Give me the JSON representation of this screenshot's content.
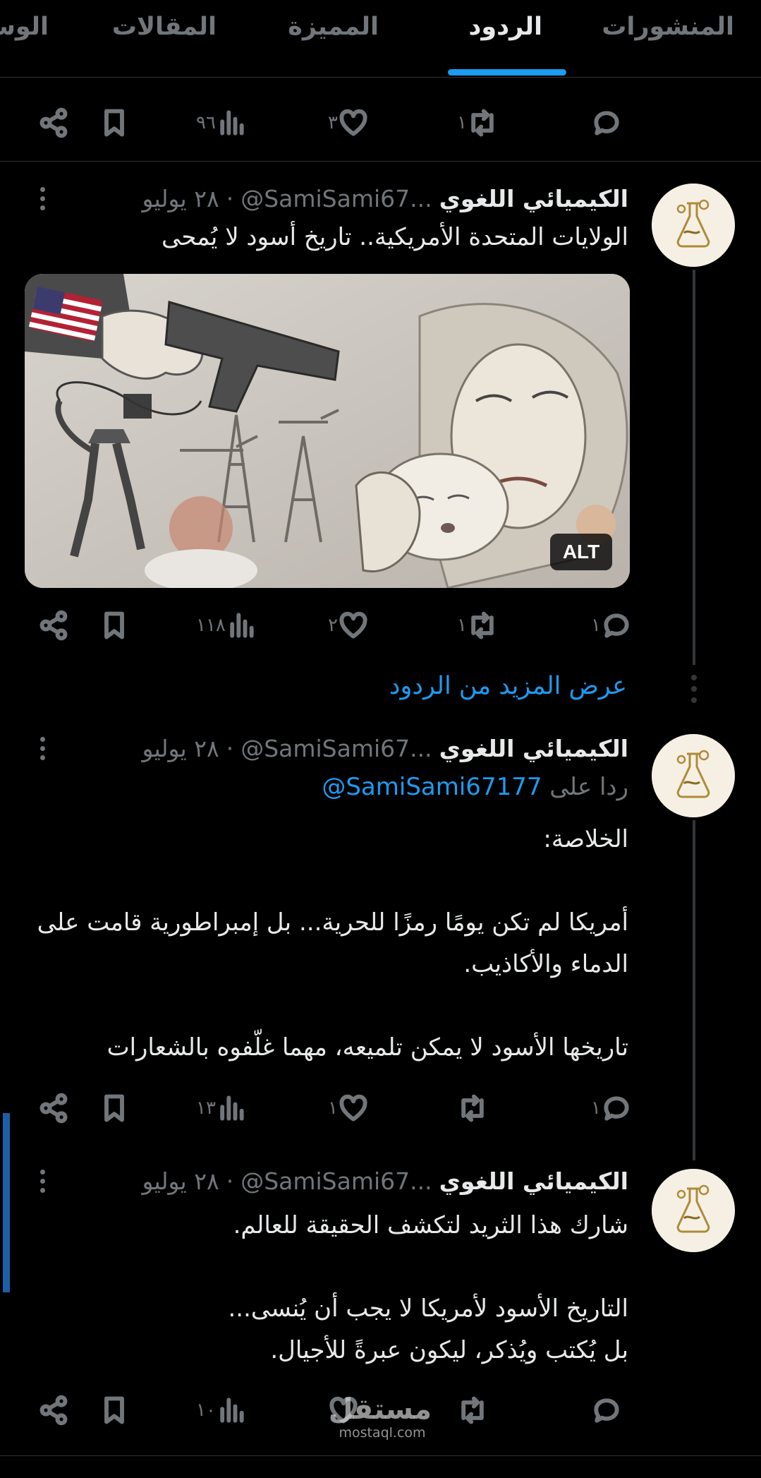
{
  "tabs": [
    {
      "label": "المنشورات",
      "active": false
    },
    {
      "label": "الردود",
      "active": true
    },
    {
      "label": "المميزة",
      "active": false
    },
    {
      "label": "المقالات",
      "active": false
    },
    {
      "label": "الوس",
      "active": false
    }
  ],
  "colors": {
    "accent": "#1d9bf0",
    "background": "#000000",
    "muted": "#71767b",
    "text": "#e7e9ea"
  },
  "top_actions": {
    "views": "٩٦",
    "likes": "٣",
    "retweets": "١",
    "replies": ""
  },
  "posts": [
    {
      "author": {
        "name": "الكيميائي اللغوي",
        "handle": "@SamiSami67...",
        "avatar_icon": "chemist-logo-avatar",
        "avatar_text": "الكيميائي اللغوي"
      },
      "date": "٢٨ يوليو",
      "separator": "·",
      "text": "الولايات المتحدة الأمريكية.. تاريخ أسود لا يُمحى",
      "media": {
        "type": "illustration",
        "alt_badge": "ALT"
      },
      "actions": {
        "views": "١١٨",
        "likes": "٢",
        "retweets": "١",
        "replies": "١"
      }
    },
    {
      "author": {
        "name": "الكيميائي اللغوي",
        "handle": "@SamiSami67...",
        "avatar_icon": "chemist-logo-avatar",
        "avatar_text": "الكيميائي اللغوي"
      },
      "date": "٢٨ يوليو",
      "separator": "·",
      "replying_prefix": "ردا على",
      "replying_to": "@SamiSami67177",
      "text": "الخلاصة:\n\nأمريكا لم تكن يومًا رمزًا للحرية... بل إمبراطورية قامت على الدماء والأكاذيب.\n\nتاريخها الأسود لا يمكن تلميعه، مهما غلّفوه بالشعارات",
      "actions": {
        "views": "١٣",
        "likes": "١",
        "retweets": "",
        "replies": "١"
      }
    },
    {
      "author": {
        "name": "الكيميائي اللغوي",
        "handle": "@SamiSami67...",
        "avatar_icon": "chemist-logo-avatar",
        "avatar_text": "الكيميائي اللغوي"
      },
      "date": "٢٨ يوليو",
      "separator": "·",
      "text": "شارك هذا الثريد لتكشف الحقيقة للعالم.\n\nالتاريخ الأسود لأمريكا لا يجب أن يُنسى...\nبل يُكتب ويُذكر، ليكون عبرةً للأجيال.",
      "actions": {
        "views": "١٠",
        "likes": "",
        "retweets": "",
        "replies": ""
      }
    }
  ],
  "show_more_replies": "عرض المزيد من الردود",
  "watermark": {
    "arabic": "مستقل",
    "latin": "mostaql.com"
  }
}
